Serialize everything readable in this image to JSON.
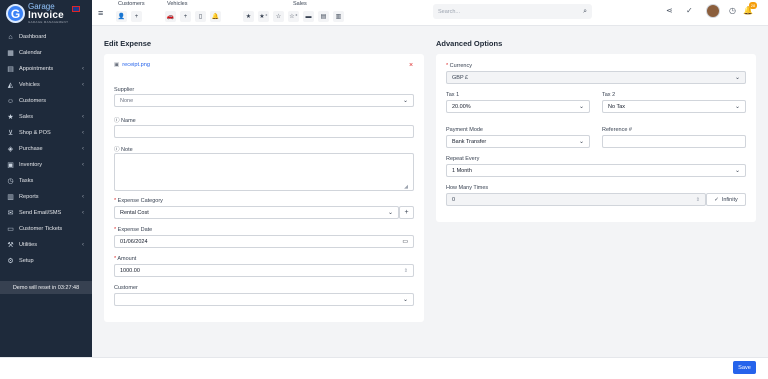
{
  "brand": {
    "line1": "Garage",
    "line2": "Invoice",
    "tagline": "GARAGE MANAGEMENT"
  },
  "sidebar": {
    "items": [
      {
        "label": "Dashboard",
        "icon": "home-icon",
        "chev": ""
      },
      {
        "label": "Calendar",
        "icon": "calendar-icon",
        "chev": ""
      },
      {
        "label": "Appointments",
        "icon": "clipboard-icon",
        "chev": "‹"
      },
      {
        "label": "Vehicles",
        "icon": "car-icon",
        "chev": "‹"
      },
      {
        "label": "Customers",
        "icon": "user-icon",
        "chev": ""
      },
      {
        "label": "Sales",
        "icon": "star-icon",
        "chev": "‹"
      },
      {
        "label": "Shop & POS",
        "icon": "cart-icon",
        "chev": "‹"
      },
      {
        "label": "Purchase",
        "icon": "purchase-icon",
        "chev": "‹"
      },
      {
        "label": "Inventory",
        "icon": "box-icon",
        "chev": "‹"
      },
      {
        "label": "Tasks",
        "icon": "clock-icon",
        "chev": ""
      },
      {
        "label": "Reports",
        "icon": "chart-icon",
        "chev": "‹"
      },
      {
        "label": "Send Email/SMS",
        "icon": "mail-icon",
        "chev": "‹"
      },
      {
        "label": "Customer Tickets",
        "icon": "ticket-icon",
        "chev": ""
      },
      {
        "label": "Utilities",
        "icon": "tools-icon",
        "chev": "‹"
      },
      {
        "label": "Setup",
        "icon": "gear-icon",
        "chev": ""
      }
    ],
    "demo_text": "Demo will reset in 03:27:48"
  },
  "topbar": {
    "groups": [
      {
        "label": "Customers",
        "buttons": [
          "👤",
          "+"
        ]
      },
      {
        "label": "Vehicles",
        "buttons": [
          "🚗",
          "+",
          "▯",
          "🔔"
        ]
      },
      {
        "label": "Sales",
        "buttons": [
          "★",
          "★⁺",
          "☆",
          "☆⁺",
          "▬",
          "▤",
          "▥"
        ]
      }
    ],
    "search_placeholder": "Search...",
    "notif_count": "28"
  },
  "edit_expense": {
    "title": "Edit Expense",
    "receipt_file": "receipt.png",
    "supplier_label": "Supplier",
    "supplier_value": "None",
    "name_label": "Name",
    "name_value": "",
    "note_label": "Note",
    "note_value": "",
    "category_label": "Expense Category",
    "category_value": "Rental Cost",
    "date_label": "Expense Date",
    "date_value": "01/06/2024",
    "amount_label": "Amount",
    "amount_value": "1000.00",
    "customer_label": "Customer",
    "customer_value": ""
  },
  "advanced": {
    "title": "Advanced Options",
    "currency_label": "Currency",
    "currency_value": "GBP £",
    "tax1_label": "Tax 1",
    "tax1_value": "20.00%",
    "tax2_label": "Tax 2",
    "tax2_value": "No Tax",
    "payment_label": "Payment Mode",
    "payment_value": "Bank Transfer",
    "reference_label": "Reference #",
    "reference_value": "",
    "repeat_label": "Repeat Every",
    "repeat_value": "1 Month",
    "times_label": "How Many Times",
    "times_value": "0",
    "infinity_label": "Infinity"
  },
  "footer": {
    "save_label": "Save"
  }
}
